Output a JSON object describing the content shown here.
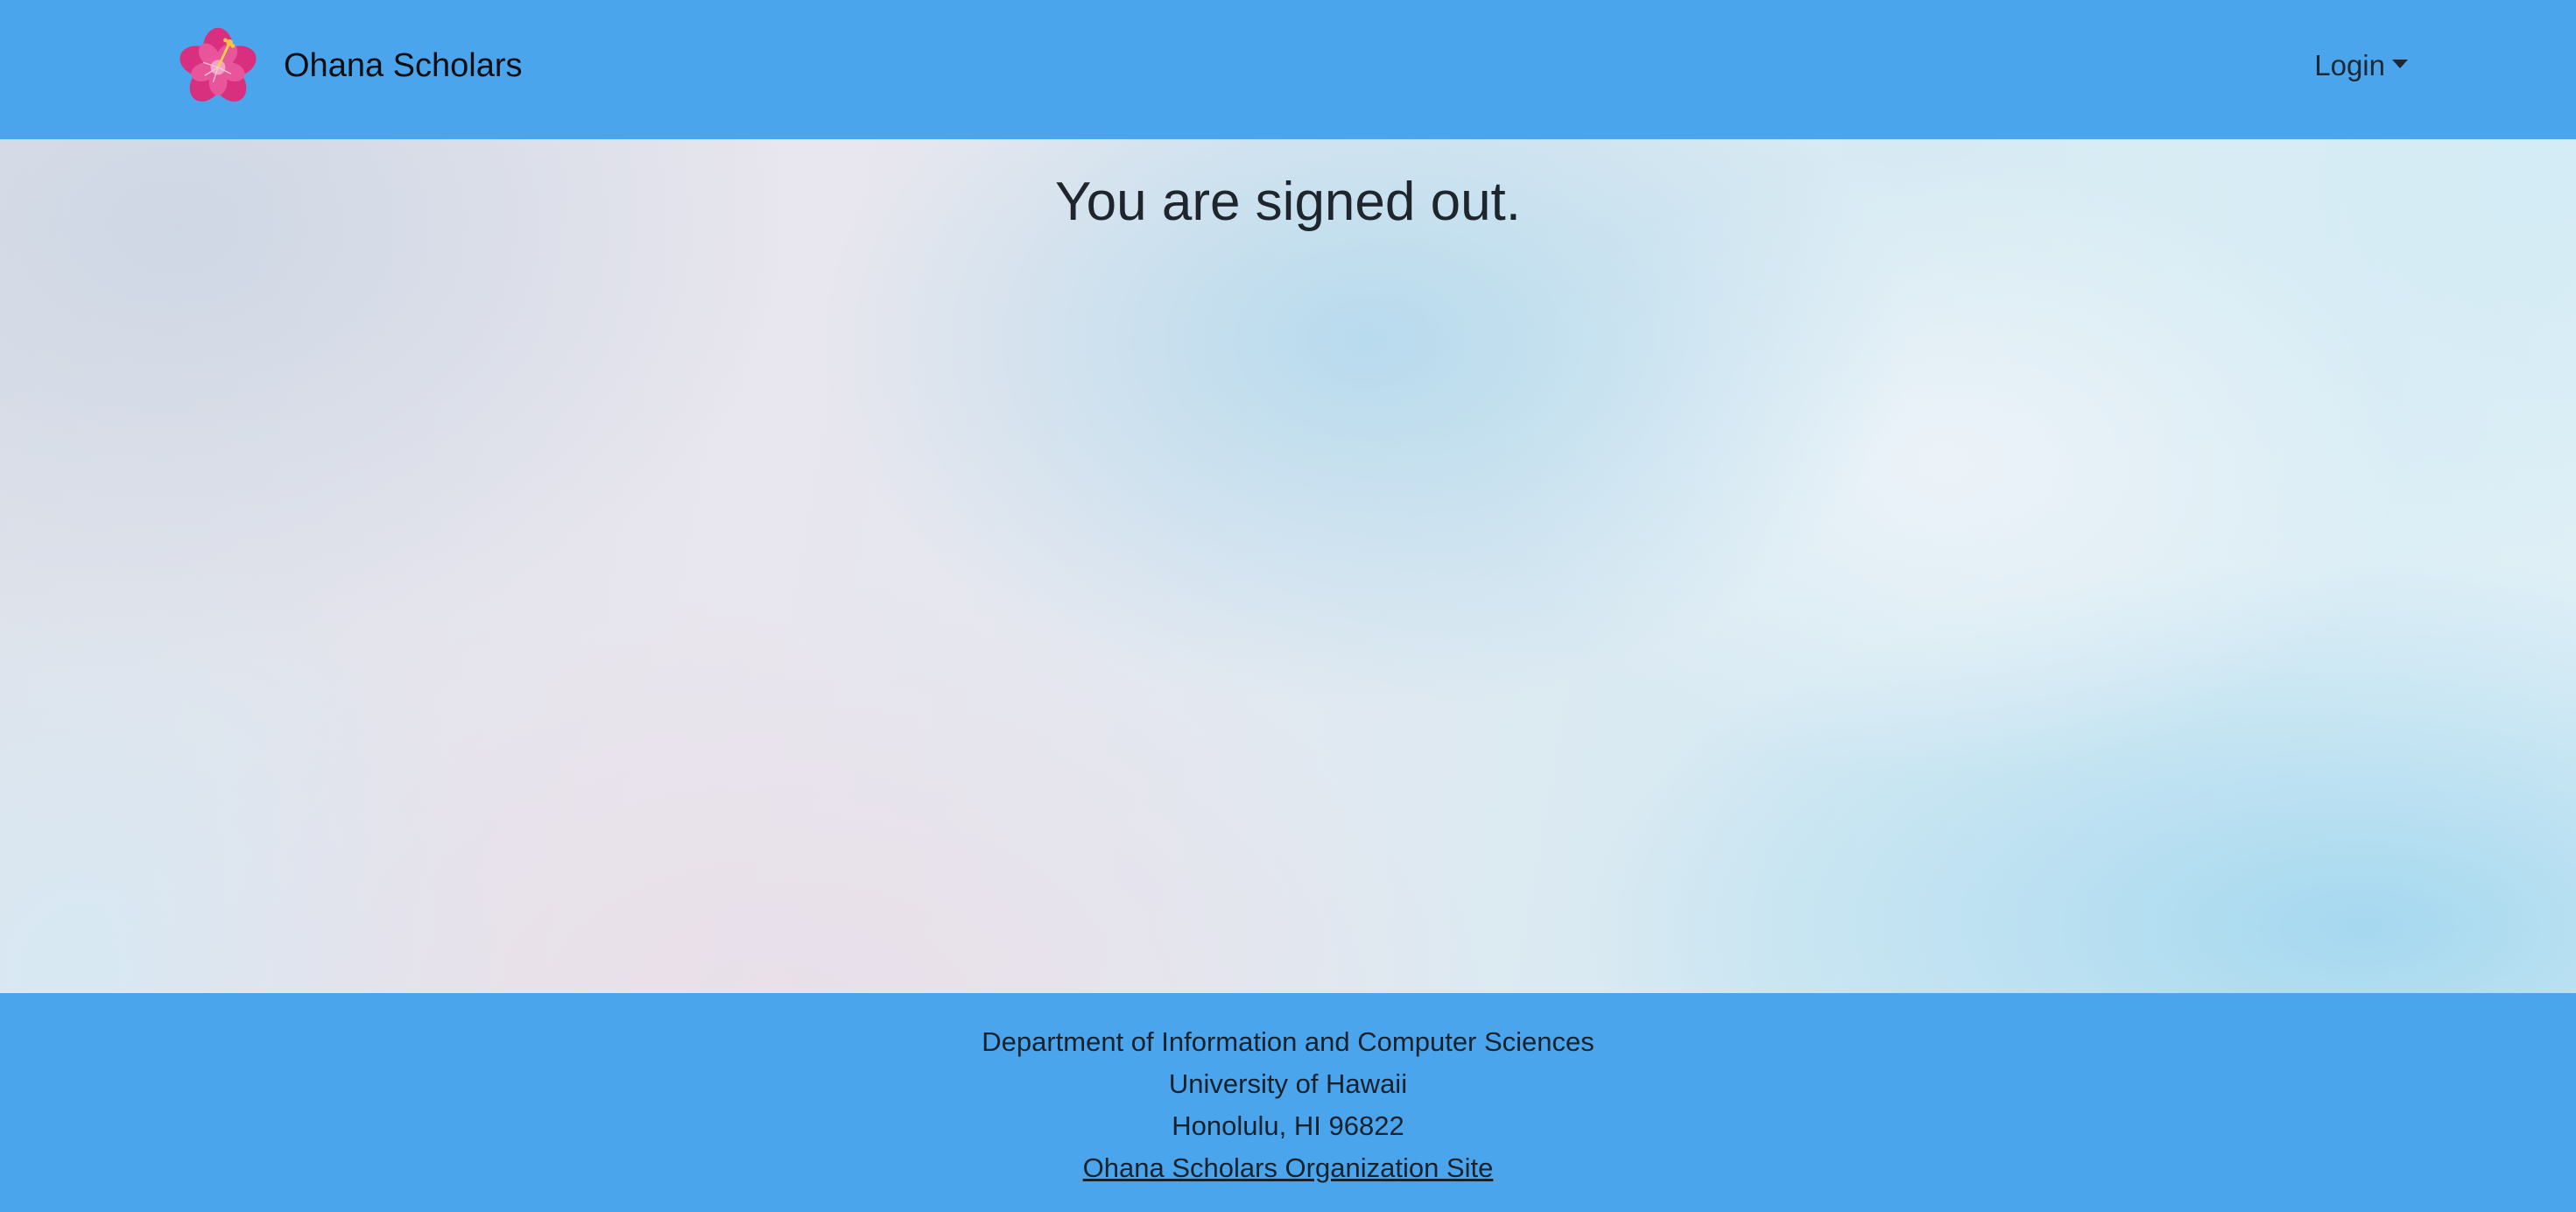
{
  "navbar": {
    "brand_name": "Ohana Scholars",
    "logo_icon": "hibiscus-flower-icon",
    "login_label": "Login",
    "background_color": "#4ba5ec"
  },
  "main": {
    "heading": "You are signed out."
  },
  "footer": {
    "department": "Department of Information and Computer Sciences",
    "university": "University of Hawaii",
    "address": "Honolulu, HI 96822",
    "org_link_label": "Ohana Scholars Organization Site",
    "background_color": "#4ba5ec"
  }
}
